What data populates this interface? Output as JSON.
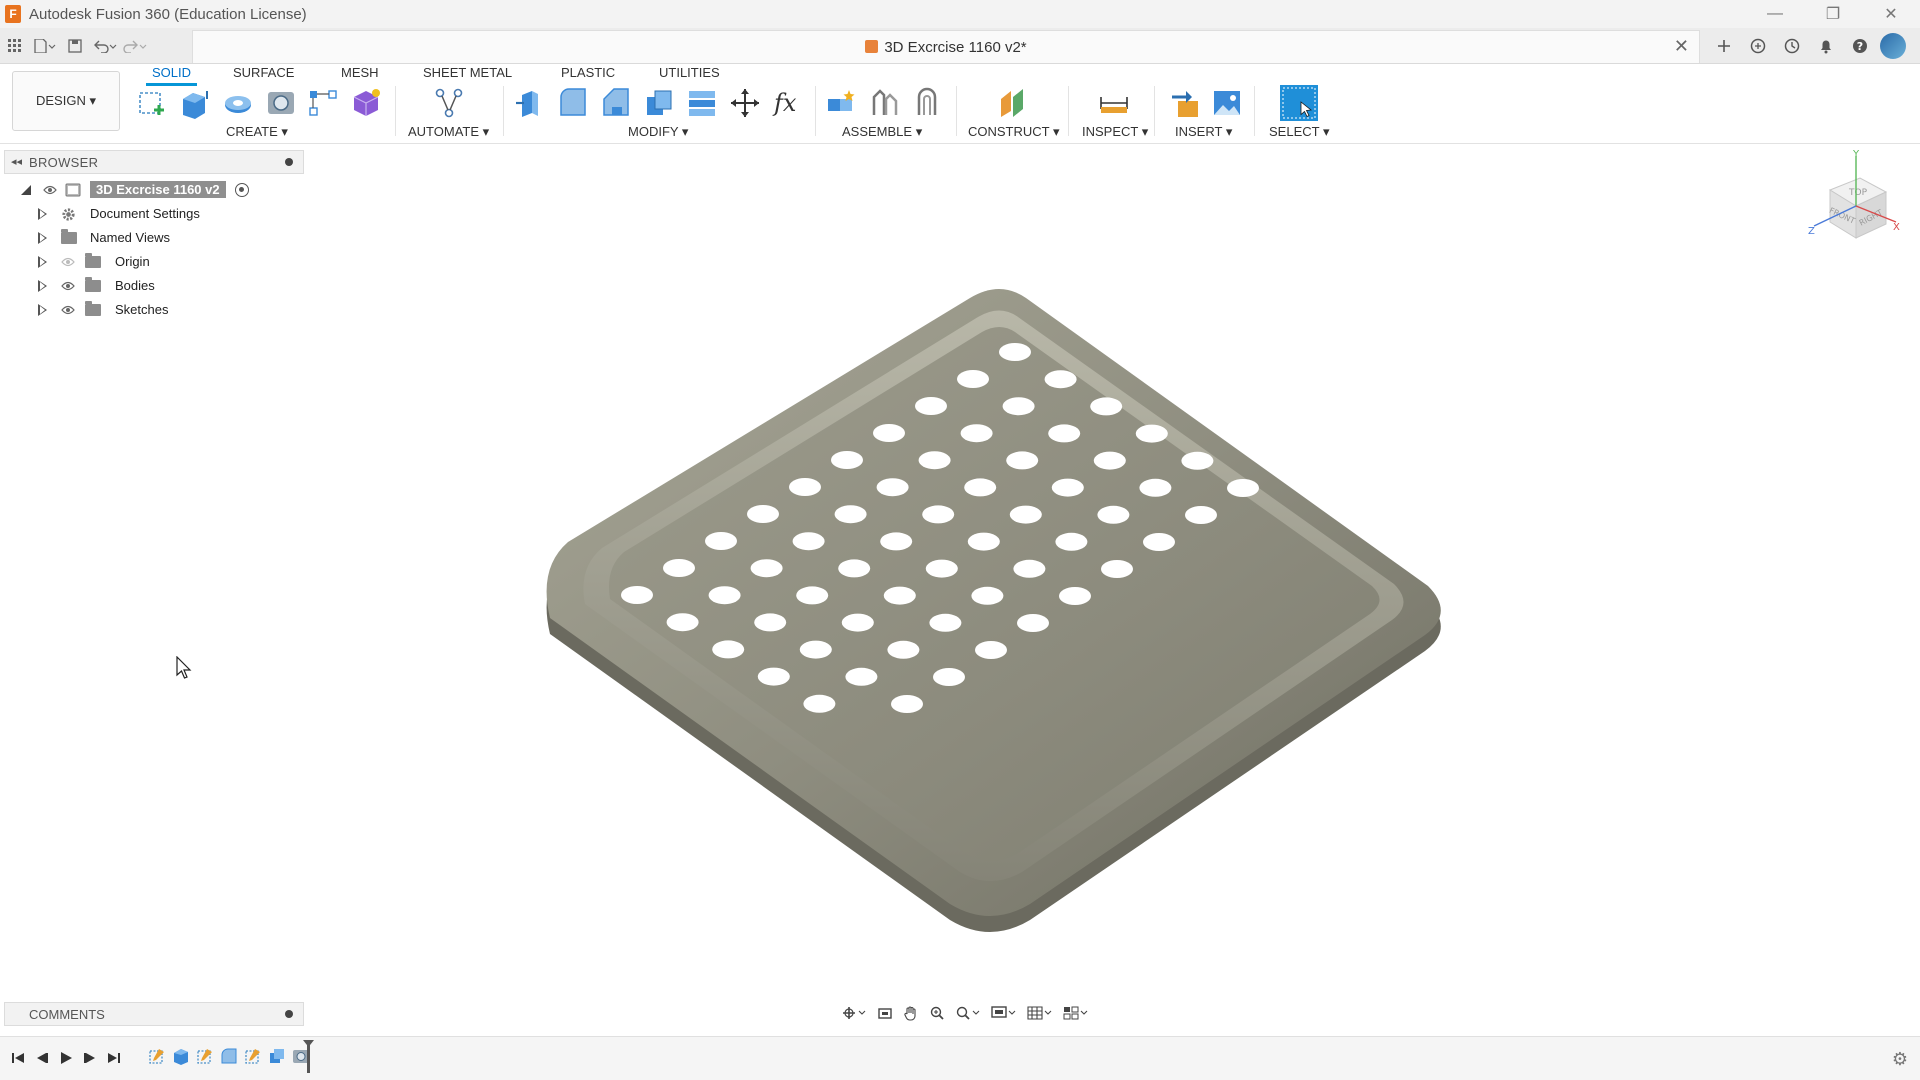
{
  "window": {
    "title": "Autodesk Fusion 360 (Education License)",
    "minimize": "—",
    "restore": "❐",
    "close": "✕"
  },
  "document": {
    "tab_title": "3D Excrcise 1160 v2*",
    "close": "✕"
  },
  "ribbon": {
    "workspace": "DESIGN ▾",
    "tabs": [
      "SOLID",
      "SURFACE",
      "MESH",
      "SHEET METAL",
      "PLASTIC",
      "UTILITIES"
    ],
    "active_tab": "SOLID",
    "groups": {
      "create": "CREATE ▾",
      "automate": "AUTOMATE ▾",
      "modify": "MODIFY ▾",
      "assemble": "ASSEMBLE ▾",
      "construct": "CONSTRUCT ▾",
      "inspect": "INSPECT ▾",
      "insert": "INSERT ▾",
      "select": "SELECT ▾"
    }
  },
  "browser": {
    "title": "BROWSER",
    "root": "3D Excrcise 1160 v2",
    "items": [
      {
        "label": "Document Settings",
        "icon": "gear-icon"
      },
      {
        "label": "Named Views",
        "icon": "folder-icon"
      },
      {
        "label": "Origin",
        "icon": "folder-icon",
        "visibility": "hidden"
      },
      {
        "label": "Bodies",
        "icon": "folder-icon",
        "visibility": "visible"
      },
      {
        "label": "Sketches",
        "icon": "folder-icon",
        "visibility": "visible"
      }
    ]
  },
  "comments": {
    "title": "COMMENTS"
  },
  "viewcube": {
    "top": "TOP",
    "front": "FRONT",
    "right": "RIGHT",
    "axis_x": "X",
    "axis_y": "Y",
    "axis_z": "Z"
  },
  "colors": {
    "accent": "#0696d7",
    "tray_base": "#8a8a7c",
    "tray_highlight": "#b4b3a4",
    "tray_shadow": "#6a6a5e",
    "hole": "#ffffff"
  }
}
